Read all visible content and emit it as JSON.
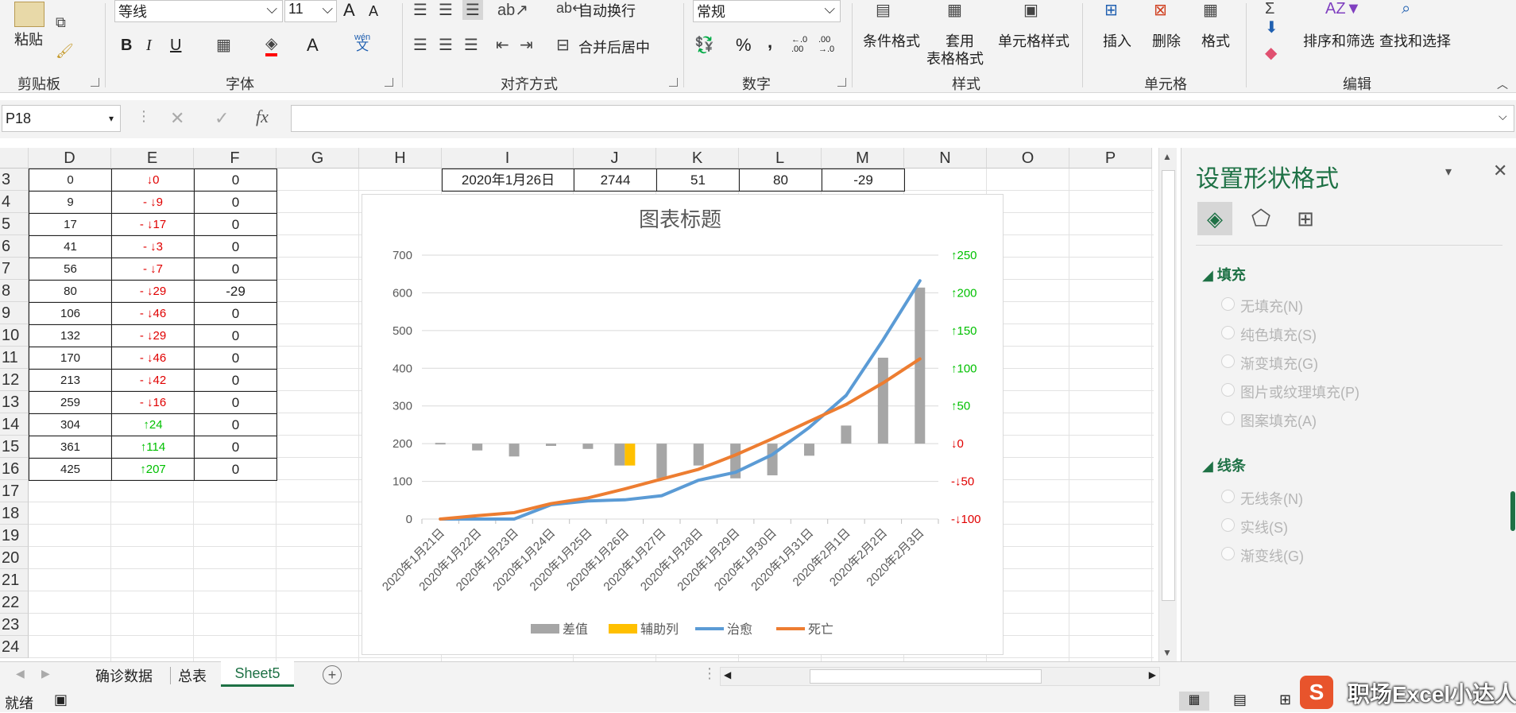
{
  "ribbon": {
    "clipboard": {
      "paste": "粘贴",
      "group": "剪贴板"
    },
    "font": {
      "name": "等线",
      "size": "11",
      "group": "字体",
      "bold": "B",
      "italic": "I",
      "underline": "U",
      "wen": "wén",
      "wen_char": "文",
      "grow": "A",
      "shrink": "A"
    },
    "alignment": {
      "wrap": "自动换行",
      "merge": "合并后居中",
      "group": "对齐方式"
    },
    "number": {
      "format": "常规",
      "group": "数字",
      "percent": "%",
      "comma": ",",
      "inc": ".0\n.00",
      "dec": ".00\n.0"
    },
    "styles": {
      "conditional": "条件格式",
      "table1": "套用",
      "table2": "表格格式",
      "cell": "单元格样式",
      "group": "样式"
    },
    "cells": {
      "insert": "插入",
      "delete": "删除",
      "format": "格式",
      "group": "单元格"
    },
    "editing": {
      "sort": "排序和筛选",
      "find": "查找和选择",
      "group": "编辑"
    }
  },
  "formula_bar": {
    "name_box": "P18",
    "fx": "fx",
    "cancel": "✕",
    "enter": "✓",
    "formula": ""
  },
  "sheet": {
    "columns": [
      "D",
      "E",
      "F",
      "G",
      "H",
      "I",
      "J",
      "K",
      "L",
      "M",
      "N",
      "O",
      "P"
    ],
    "rows": [
      "3",
      "4",
      "5",
      "6",
      "7",
      "8",
      "9",
      "10",
      "11",
      "12",
      "13",
      "14",
      "15",
      "16",
      "17",
      "18",
      "19",
      "20",
      "21",
      "22",
      "23",
      "24"
    ],
    "d_values": [
      "0",
      "9",
      "17",
      "41",
      "56",
      "80",
      "106",
      "132",
      "170",
      "213",
      "259",
      "304",
      "361",
      "425"
    ],
    "e_values": [
      "↓0",
      "- ↓9",
      "- ↓17",
      "- ↓3",
      "- ↓7",
      "- ↓29",
      "- ↓46",
      "- ↓29",
      "- ↓46",
      "- ↓42",
      "- ↓16",
      "↑24",
      "↑114",
      "↑207"
    ],
    "e_up": [
      false,
      false,
      false,
      false,
      false,
      false,
      false,
      false,
      false,
      false,
      false,
      true,
      true,
      true
    ],
    "f_values": [
      "0",
      "0",
      "0",
      "0",
      "0",
      "-29",
      "0",
      "0",
      "0",
      "0",
      "0",
      "0",
      "0",
      "0"
    ],
    "row3_extra": {
      "I": "2020年1月26日",
      "J": "2744",
      "K": "51",
      "L": "80",
      "M": "-29"
    }
  },
  "chart_data": {
    "type": "bar",
    "title": "图表标题",
    "categories": [
      "2020年1月21日",
      "2020年1月22日",
      "2020年1月23日",
      "2020年1月24日",
      "2020年1月25日",
      "2020年1月26日",
      "2020年1月27日",
      "2020年1月28日",
      "2020年1月29日",
      "2020年1月30日",
      "2020年1月31日",
      "2020年2月1日",
      "2020年2月2日",
      "2020年2月3日"
    ],
    "ylim": [
      0,
      700
    ],
    "y_ticks": [
      "0",
      "100",
      "200",
      "300",
      "400",
      "500",
      "600",
      "700"
    ],
    "y2_ticks": [
      "-↓100",
      "-↓50",
      "↓0",
      "↑50",
      "↑100",
      "↑150",
      "↑200",
      "↑250"
    ],
    "y2_colors": [
      "#e00000",
      "#e00000",
      "#e00000",
      "#00c000",
      "#00c000",
      "#00c000",
      "#00c000",
      "#00c000"
    ],
    "series": [
      {
        "name": "差值",
        "kind": "bar",
        "color": "#a6a6a6",
        "values": [
          0,
          -9,
          -17,
          -3,
          -7,
          -29,
          -46,
          -29,
          -46,
          -42,
          -16,
          24,
          114,
          207
        ]
      },
      {
        "name": "辅助列",
        "kind": "bar",
        "color": "#ffc000",
        "values": [
          0,
          0,
          0,
          0,
          0,
          -29,
          0,
          0,
          0,
          0,
          0,
          0,
          0,
          0
        ]
      },
      {
        "name": "治愈",
        "kind": "line",
        "color": "#5b9bd5",
        "values": [
          0,
          0,
          0,
          38,
          48,
          51,
          62,
          103,
          124,
          171,
          243,
          328,
          475,
          632
        ]
      },
      {
        "name": "死亡",
        "kind": "line",
        "color": "#ed7d31",
        "values": [
          0,
          9,
          17,
          41,
          56,
          80,
          106,
          132,
          170,
          213,
          259,
          304,
          361,
          425
        ]
      }
    ],
    "legend": "bottom"
  },
  "pane": {
    "title": "设置形状格式",
    "fill_section": "填充",
    "fill_options": [
      "无填充(N)",
      "纯色填充(S)",
      "渐变填充(G)",
      "图片或纹理填充(P)",
      "图案填充(A)"
    ],
    "line_section": "线条",
    "line_options": [
      "无线条(N)",
      "实线(S)",
      "渐变线(G)"
    ]
  },
  "tabs": [
    "确诊数据",
    "总表",
    "Sheet5"
  ],
  "active_tab": "Sheet5",
  "status": {
    "ready": "就绪"
  },
  "watermark": "职场Excel小达人"
}
